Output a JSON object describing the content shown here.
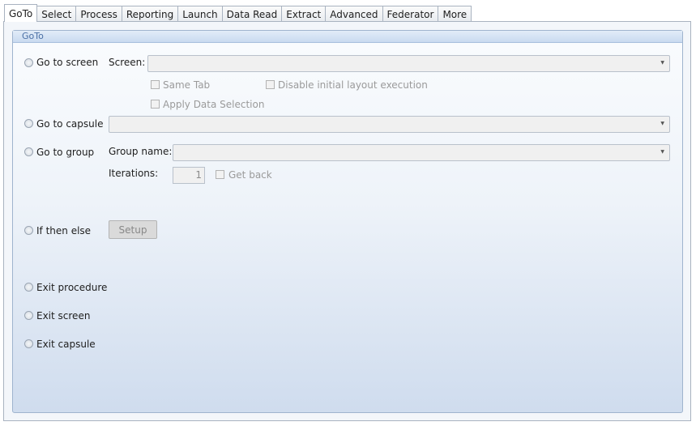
{
  "tabs": [
    "GoTo",
    "Select",
    "Process",
    "Reporting",
    "Launch",
    "Data Read",
    "Extract",
    "Advanced",
    "Federator",
    "More"
  ],
  "group_title": "GoTo",
  "goto_screen": {
    "radio_label": "Go to screen",
    "field_label": "Screen:",
    "same_tab": "Same Tab",
    "disable_initial_layout": "Disable initial layout execution",
    "apply_data_selection": "Apply Data Selection"
  },
  "goto_capsule": {
    "radio_label": "Go to capsule"
  },
  "goto_group": {
    "radio_label": "Go to group",
    "group_name_label": "Group name:",
    "iterations_label": "Iterations:",
    "iterations_value": "1",
    "get_back": "Get back"
  },
  "if_then_else": {
    "radio_label": "If then else",
    "setup_button": "Setup"
  },
  "exit_procedure": "Exit procedure",
  "exit_screen": "Exit screen",
  "exit_capsule": "Exit capsule",
  "icons": {
    "dropdown": "chevron-down-icon"
  }
}
